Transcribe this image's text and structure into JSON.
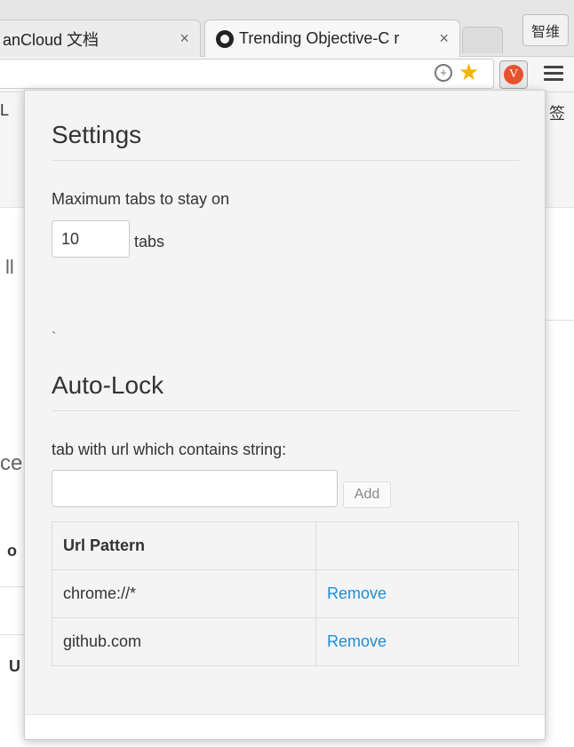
{
  "browser": {
    "tabs": [
      {
        "title": "anCloud 文档",
        "close": "×"
      },
      {
        "title": "Trending Objective-C r",
        "close": "×"
      }
    ],
    "profile_label": "智维",
    "ext_badge": "V",
    "zoom_glyph": "+",
    "star_glyph": "★",
    "icons": [
      "github-icon",
      "zoom-icon",
      "star-icon",
      "extension-icon",
      "menu-icon"
    ]
  },
  "background_page": {
    "frag_top_left": "L",
    "frag_top_right": "签",
    "frag_1": "ll",
    "frag_2": "ce",
    "frag_3": "o",
    "frag_4": "U"
  },
  "settings": {
    "title": "Settings",
    "max_tabs_label": "Maximum tabs to stay on",
    "max_tabs_value": "10",
    "tabs_unit": "tabs",
    "stray_mark": "`"
  },
  "autolock": {
    "title": "Auto-Lock",
    "prompt": "tab with url which contains string:",
    "input_value": "",
    "add_label": "Add",
    "table": {
      "headers": [
        "Url Pattern",
        ""
      ],
      "rows": [
        {
          "pattern": "chrome://*",
          "action": "Remove"
        },
        {
          "pattern": "github.com",
          "action": "Remove"
        }
      ]
    }
  },
  "colors": {
    "link": "#1a8fd8",
    "extension_badge": "#e8512c",
    "star": "#f4b400"
  }
}
